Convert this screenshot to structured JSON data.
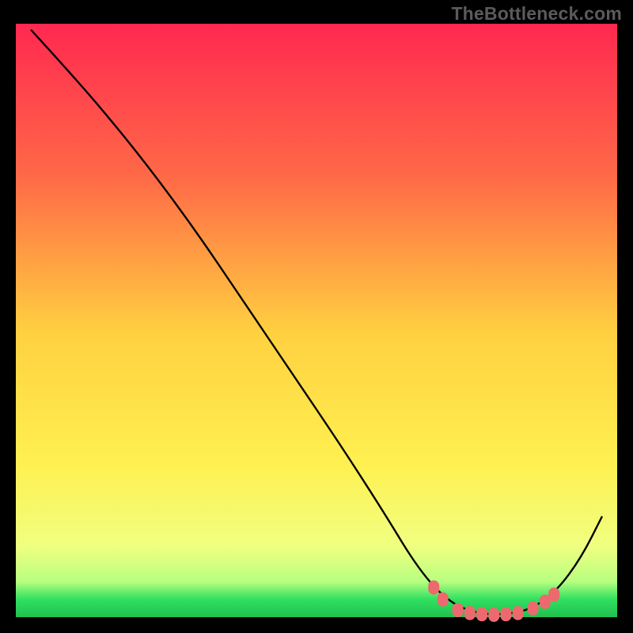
{
  "attribution": "TheBottleneck.com",
  "chart_data": {
    "type": "line",
    "title": "",
    "xlabel": "",
    "ylabel": "",
    "xlim": [
      0,
      100
    ],
    "ylim": [
      0,
      100
    ],
    "gradient_colors": {
      "top": "#ff2850",
      "mid_upper": "#ff8040",
      "mid": "#ffd040",
      "mid_lower": "#fff050",
      "lower_band": "#f0ff80",
      "green": "#30e060",
      "bottom": "#20c050"
    },
    "curve": [
      {
        "x": 2.5,
        "y": 99.0
      },
      {
        "x": 7.0,
        "y": 94.0
      },
      {
        "x": 14.0,
        "y": 86.0
      },
      {
        "x": 22.0,
        "y": 76.0
      },
      {
        "x": 30.0,
        "y": 65.0
      },
      {
        "x": 38.0,
        "y": 53.0
      },
      {
        "x": 46.0,
        "y": 41.0
      },
      {
        "x": 54.0,
        "y": 29.0
      },
      {
        "x": 61.0,
        "y": 18.0
      },
      {
        "x": 67.0,
        "y": 8.0
      },
      {
        "x": 72.0,
        "y": 2.5
      },
      {
        "x": 77.0,
        "y": 0.5
      },
      {
        "x": 82.0,
        "y": 0.5
      },
      {
        "x": 86.0,
        "y": 1.5
      },
      {
        "x": 90.0,
        "y": 4.5
      },
      {
        "x": 94.0,
        "y": 10.0
      },
      {
        "x": 97.5,
        "y": 17.0
      }
    ],
    "markers": [
      {
        "x": 69.5,
        "y": 5.0
      },
      {
        "x": 71.0,
        "y": 3.0
      },
      {
        "x": 73.5,
        "y": 1.2
      },
      {
        "x": 75.5,
        "y": 0.7
      },
      {
        "x": 77.5,
        "y": 0.5
      },
      {
        "x": 79.5,
        "y": 0.4
      },
      {
        "x": 81.5,
        "y": 0.5
      },
      {
        "x": 83.5,
        "y": 0.7
      },
      {
        "x": 86.0,
        "y": 1.5
      },
      {
        "x": 88.0,
        "y": 2.6
      },
      {
        "x": 89.5,
        "y": 3.8
      }
    ]
  }
}
